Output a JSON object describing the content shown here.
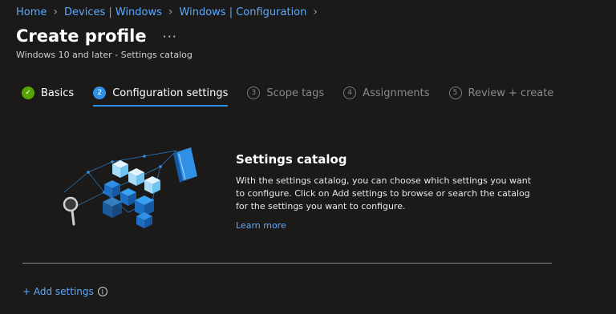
{
  "breadcrumb": [
    "Home",
    "Devices | Windows",
    "Windows | Configuration"
  ],
  "header": {
    "title": "Create profile",
    "more": "···",
    "subtitle": "Windows 10 and later - Settings catalog"
  },
  "steps": [
    {
      "number": "✓",
      "label": "Basics",
      "state": "done"
    },
    {
      "number": "2",
      "label": "Configuration settings",
      "state": "active"
    },
    {
      "number": "3",
      "label": "Scope tags",
      "state": "todo"
    },
    {
      "number": "4",
      "label": "Assignments",
      "state": "todo"
    },
    {
      "number": "5",
      "label": "Review + create",
      "state": "todo"
    }
  ],
  "catalog": {
    "title": "Settings catalog",
    "description": "With the settings catalog, you can choose which settings you want to configure. Click on Add settings to browse or search the catalog for the settings you want to configure.",
    "learn_more": "Learn more"
  },
  "add_settings": {
    "label": "+ Add settings",
    "info_icon": "info-icon",
    "info_glyph": "i"
  },
  "colors": {
    "background": "#1b1a19",
    "link": "#5aa9ff",
    "accent": "#2f90e6",
    "success": "#57a300"
  }
}
